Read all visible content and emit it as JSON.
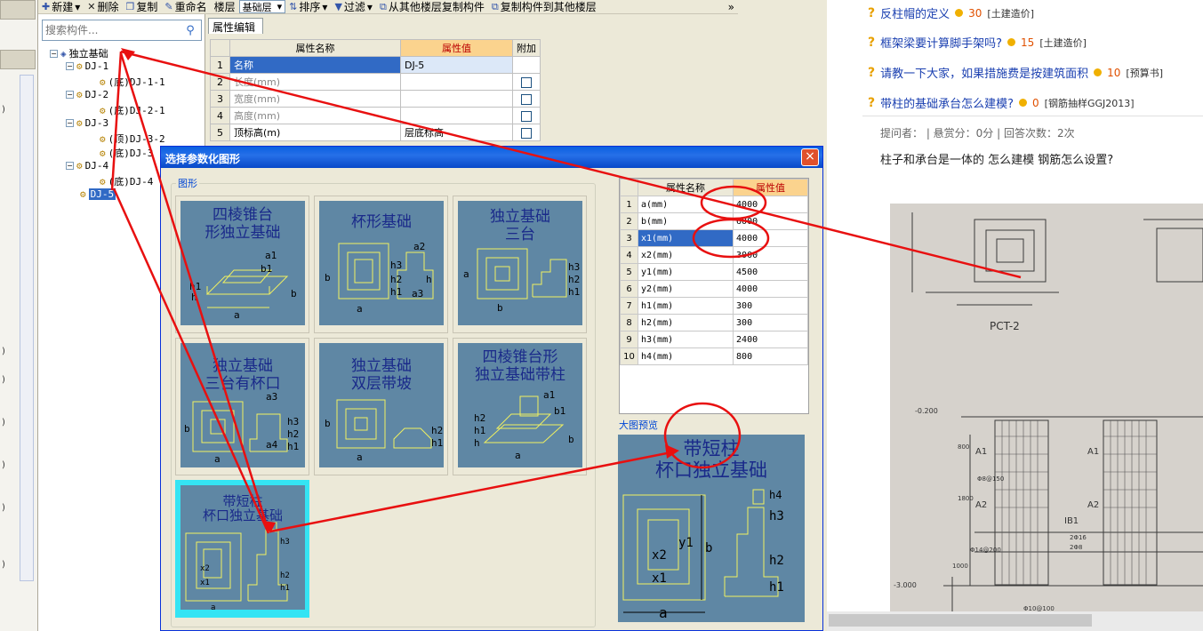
{
  "toolbar": {
    "new_label": "新建",
    "delete_label": "删除",
    "copy_label": "复制",
    "rename_label": "重命名",
    "floor_label": "楼层",
    "floor_value": "基础层",
    "sort_label": "排序",
    "filter_label": "过滤",
    "copy_from_label": "从其他楼层复制构件",
    "copy_to_label": "复制构件到其他楼层",
    "more_label": "»"
  },
  "search": {
    "placeholder": "搜索构件..."
  },
  "tree": {
    "root": "独立基础",
    "items": [
      {
        "label": "DJ-1",
        "children": [
          "(底)DJ-1-1"
        ]
      },
      {
        "label": "DJ-2",
        "children": [
          "(底)DJ-2-1"
        ]
      },
      {
        "label": "DJ-3",
        "children": [
          "(顶)DJ-3-2",
          "(底)DJ-3"
        ]
      },
      {
        "label": "DJ-4",
        "children": [
          "(底)DJ-4"
        ]
      },
      {
        "label": "DJ-5",
        "children": []
      }
    ]
  },
  "props": {
    "tab": "属性编辑",
    "col_name": "属性名称",
    "col_value": "属性值",
    "col_extra": "附加",
    "rows": [
      {
        "n": "1",
        "name": "名称",
        "value": "DJ-5",
        "checkbox": false
      },
      {
        "n": "2",
        "name": "长度(mm)",
        "value": "",
        "checkbox": true
      },
      {
        "n": "3",
        "name": "宽度(mm)",
        "value": "",
        "checkbox": true
      },
      {
        "n": "4",
        "name": "高度(mm)",
        "value": "",
        "checkbox": true
      },
      {
        "n": "5",
        "name": "顶标高(m)",
        "value": "层底标高",
        "checkbox": true
      }
    ]
  },
  "dialog": {
    "title": "选择参数化图形",
    "close": "×",
    "group_label": "图形",
    "shapes": [
      {
        "title_lines": [
          "四棱锥台",
          "形独立基础"
        ]
      },
      {
        "title_lines": [
          "杯形基础"
        ]
      },
      {
        "title_lines": [
          "独立基础",
          "三台"
        ]
      },
      {
        "title_lines": [
          "独立基础",
          "三台有杯口"
        ]
      },
      {
        "title_lines": [
          "独立基础",
          "双层带坡"
        ]
      },
      {
        "title_lines": [
          "四棱锥台形",
          "独立基础带柱"
        ]
      },
      {
        "title_lines": [
          "带短柱",
          "杯口独立基础"
        ]
      }
    ],
    "param_col_name": "属性名称",
    "param_col_value": "属性值",
    "params": [
      {
        "n": "1",
        "name": "a(mm)",
        "value": "4000"
      },
      {
        "n": "2",
        "name": "b(mm)",
        "value": "6000"
      },
      {
        "n": "3",
        "name": "x1(mm)",
        "value": "4000"
      },
      {
        "n": "4",
        "name": "x2(mm)",
        "value": "3000"
      },
      {
        "n": "5",
        "name": "y1(mm)",
        "value": "4500"
      },
      {
        "n": "6",
        "name": "y2(mm)",
        "value": "4000"
      },
      {
        "n": "7",
        "name": "h1(mm)",
        "value": "300"
      },
      {
        "n": "8",
        "name": "h2(mm)",
        "value": "300"
      },
      {
        "n": "9",
        "name": "h3(mm)",
        "value": "2400"
      },
      {
        "n": "10",
        "name": "h4(mm)",
        "value": "800"
      }
    ],
    "preview_label": "大图预览",
    "preview_title_lines": [
      "带短柱",
      "杯口独立基础"
    ]
  },
  "qa": {
    "questions": [
      {
        "title": "反柱帽的定义",
        "points": "30",
        "category": "[土建造价]"
      },
      {
        "title": "框架梁要计算脚手架吗?",
        "points": "15",
        "category": "[土建造价]"
      },
      {
        "title": "请教一下大家，如果措施费是按建筑面积",
        "points": "10",
        "category": "[预算书]"
      },
      {
        "title": "带柱的基础承台怎么建模?",
        "points": "0",
        "category": "[钢筋抽样GGJ2013]"
      }
    ],
    "meta": "提问者：  |  悬赏分：0分  |  回答次数：2次",
    "question_text": "柱子和承台是一体的 怎么建模 钢筋怎么设置?",
    "photo_labels": [
      "PCT-2",
      "A1",
      "A2",
      "IB1",
      "A1",
      "A2",
      "-0.200",
      "-3.000",
      "800",
      "1800",
      "1000",
      "Φ8@150",
      "Φ14@200",
      "Φ10@100",
      "2Φ16",
      "2Φ8"
    ]
  },
  "colors": {
    "accent_red": "#e81010",
    "card_bg": "#5f87a4",
    "select_blue": "#316ac5",
    "header_orange": "#fbd38e"
  }
}
